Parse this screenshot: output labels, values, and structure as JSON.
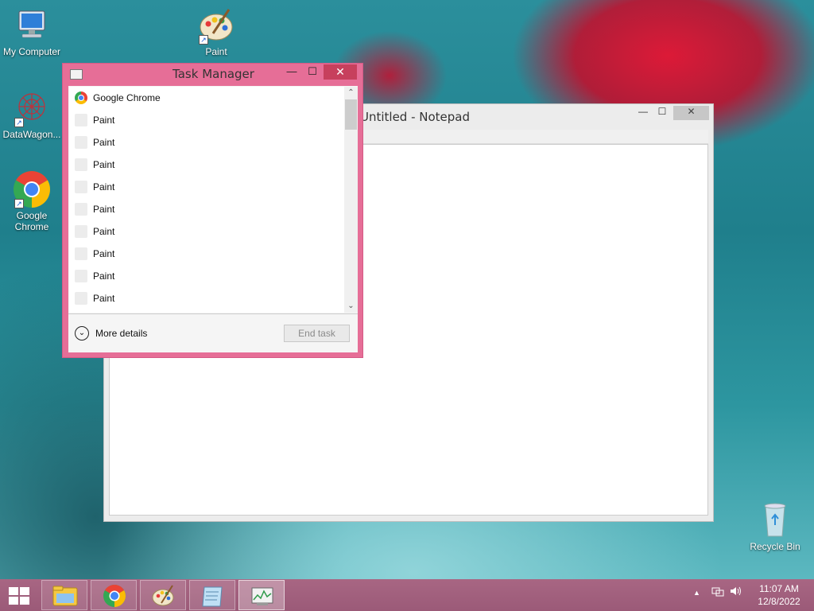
{
  "desktop": {
    "icons": [
      {
        "label": "My Computer"
      },
      {
        "label": "Paint"
      },
      {
        "label": "DataWagon..."
      },
      {
        "label": "Google Chrome"
      },
      {
        "label": "Recycle Bin"
      }
    ]
  },
  "notepad": {
    "title": "Untitled - Notepad",
    "minimize": "—",
    "maximize": "☐",
    "close": "✕"
  },
  "task_manager": {
    "title": "Task Manager",
    "minimize": "—",
    "maximize": "☐",
    "close": "✕",
    "processes": [
      {
        "name": "Google Chrome",
        "icon": "chrome-icon"
      },
      {
        "name": "Paint",
        "icon": "app-icon"
      },
      {
        "name": "Paint",
        "icon": "app-icon"
      },
      {
        "name": "Paint",
        "icon": "app-icon"
      },
      {
        "name": "Paint",
        "icon": "app-icon"
      },
      {
        "name": "Paint",
        "icon": "app-icon"
      },
      {
        "name": "Paint",
        "icon": "app-icon"
      },
      {
        "name": "Paint",
        "icon": "app-icon"
      },
      {
        "name": "Paint",
        "icon": "app-icon"
      },
      {
        "name": "Paint",
        "icon": "app-icon"
      }
    ],
    "more_details": "More details",
    "end_task": "End task",
    "scroll_up": "⌃",
    "scroll_down": "⌄"
  },
  "taskbar": {
    "apps": [
      {
        "name": "file-explorer"
      },
      {
        "name": "google-chrome"
      },
      {
        "name": "paint"
      },
      {
        "name": "notepad"
      },
      {
        "name": "task-manager"
      }
    ],
    "tray_arrow": "▲",
    "clock_time": "11:07 AM",
    "clock_date": "12/8/2022"
  },
  "colors": {
    "task_manager_frame": "#e66e97",
    "taskbar": "#9b5a78",
    "close_button": "#c7405d"
  }
}
